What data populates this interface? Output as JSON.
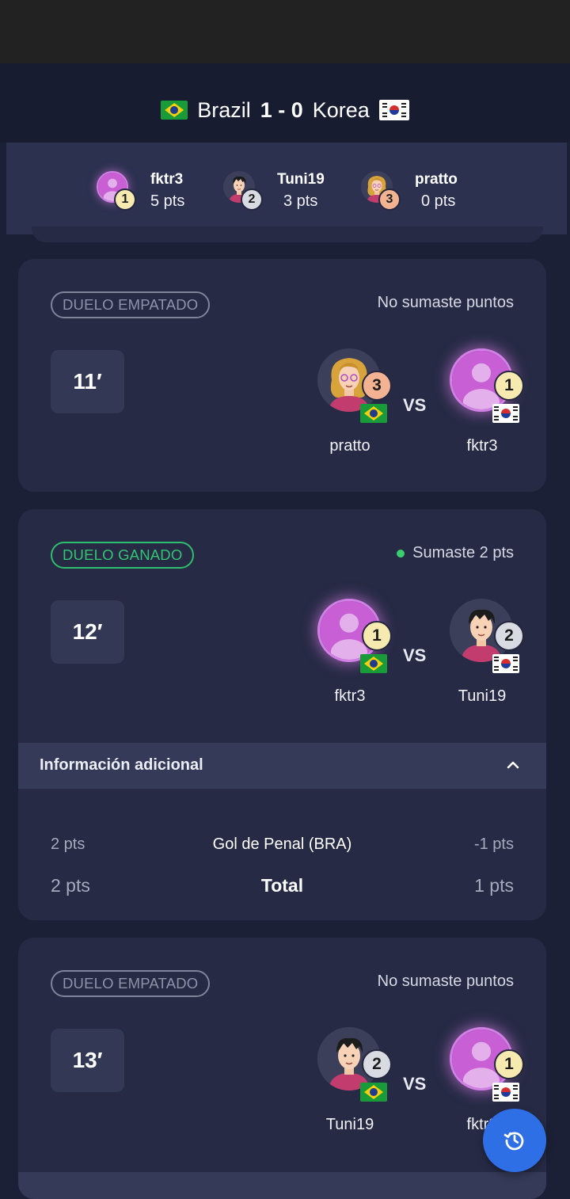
{
  "match": {
    "home_team": "Brazil",
    "score": "1 - 0",
    "away_team": "Korea",
    "home_flag": "brazil-flag",
    "away_flag": "korea-flag"
  },
  "leaderboard": [
    {
      "rank": "1",
      "name": "fktr3",
      "points": "5 pts",
      "avatar": "default-user-avatar"
    },
    {
      "rank": "2",
      "name": "Tuni19",
      "points": "3 pts",
      "avatar": "dark-hair-man-avatar"
    },
    {
      "rank": "3",
      "name": "pratto",
      "points": "0 pts",
      "avatar": "blonde-woman-avatar"
    }
  ],
  "duels": [
    {
      "status": "DUELO EMPATADO",
      "result_text": "No sumaste puntos",
      "minute": "11′",
      "left": {
        "name": "pratto",
        "rank": "3",
        "flag": "brazil-flag"
      },
      "vs": "VS",
      "right": {
        "name": "fktr3",
        "rank": "1",
        "flag": "korea-flag"
      }
    },
    {
      "status": "DUELO GANADO",
      "result_text": "Sumaste 2 pts",
      "minute": "12′",
      "left": {
        "name": "fktr3",
        "rank": "1",
        "flag": "brazil-flag"
      },
      "vs": "VS",
      "right": {
        "name": "Tuni19",
        "rank": "2",
        "flag": "korea-flag"
      },
      "info": {
        "title": "Información adicional",
        "rows": [
          {
            "left": "2 pts",
            "label": "Gol de Penal (BRA)",
            "right": "-1 pts"
          },
          {
            "left": "2 pts",
            "label": "Total",
            "right": "1 pts"
          }
        ]
      }
    },
    {
      "status": "DUELO EMPATADO",
      "result_text": "No sumaste puntos",
      "minute": "13′",
      "left": {
        "name": "Tuni19",
        "rank": "2",
        "flag": "brazil-flag"
      },
      "vs": "VS",
      "right": {
        "name": "fktr3",
        "rank": "1",
        "flag": "korea-flag"
      }
    }
  ],
  "colors": {
    "background": "#1c2036",
    "card": "#262a45",
    "accent_green": "#33c473",
    "fab_blue": "#2f6fe6"
  },
  "fab": {
    "icon": "history-icon"
  }
}
